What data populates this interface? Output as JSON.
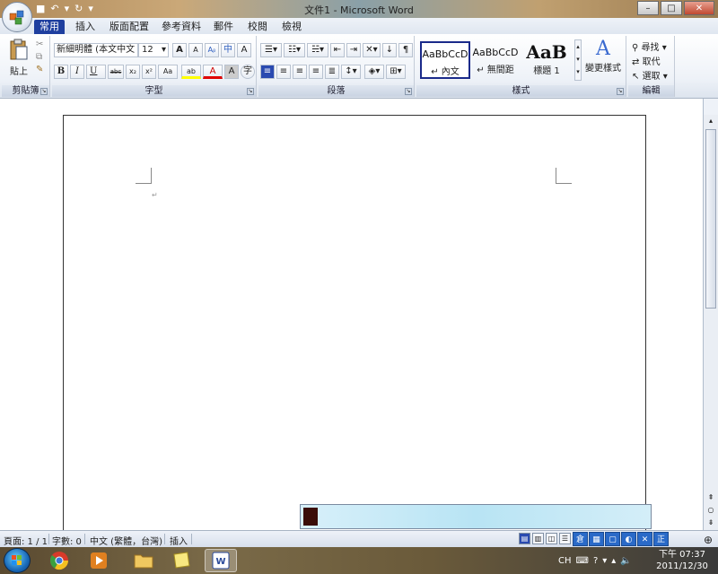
{
  "window": {
    "title": "文件1 - Microsoft Word",
    "minimize": "–",
    "maximize": "□",
    "close": "✕"
  },
  "qat": {
    "save": "■",
    "undo": "↶",
    "redo": "↻",
    "more": "▾"
  },
  "tabs": [
    "常用",
    "插入",
    "版面配置",
    "參考資料",
    "郵件",
    "校閱",
    "檢視"
  ],
  "ribbon": {
    "clipboard": {
      "label": "剪貼簿",
      "paste": "貼上"
    },
    "font": {
      "label": "字型",
      "font_name": "新細明體 (本文中文",
      "font_size": "12",
      "grow": "A",
      "shrink": "A",
      "clear": "Aᵦ",
      "phonetic": "中",
      "border_char": "A",
      "bold": "B",
      "italic": "I",
      "underline": "U",
      "strike": "abc",
      "subscript": "x₂",
      "superscript": "x²",
      "case": "Aa",
      "highlight": "ab",
      "font_color": "A",
      "shade": "A",
      "circle": "字"
    },
    "paragraph": {
      "label": "段落"
    },
    "styles": {
      "label": "樣式",
      "items": [
        {
          "sample": "AaBbCcD",
          "name": "↵ 內文"
        },
        {
          "sample": "AaBbCcD",
          "name": "↵ 無間距"
        },
        {
          "sample": "AaB",
          "name": "標題 1"
        }
      ],
      "change": "變更樣式"
    },
    "editing": {
      "label": "編輯",
      "find": "尋找",
      "replace": "取代",
      "select": "選取"
    }
  },
  "document": {
    "paragraph_mark": "↵"
  },
  "status": {
    "page": "頁面: 1 / 1",
    "words": "字數: 0",
    "language": "中文 (繁體，台灣)",
    "mode": "插入"
  },
  "ime_tools": [
    "倉",
    "",
    "",
    "",
    "",
    "",
    "正"
  ],
  "taskbar": {
    "lang": "CH",
    "time": "下午 07:37",
    "date": "2011/12/30"
  },
  "colors": {
    "tab_active": "#1f3f9f",
    "highlight_bar": "#ffff00",
    "font_color_bar": "#e00000"
  }
}
